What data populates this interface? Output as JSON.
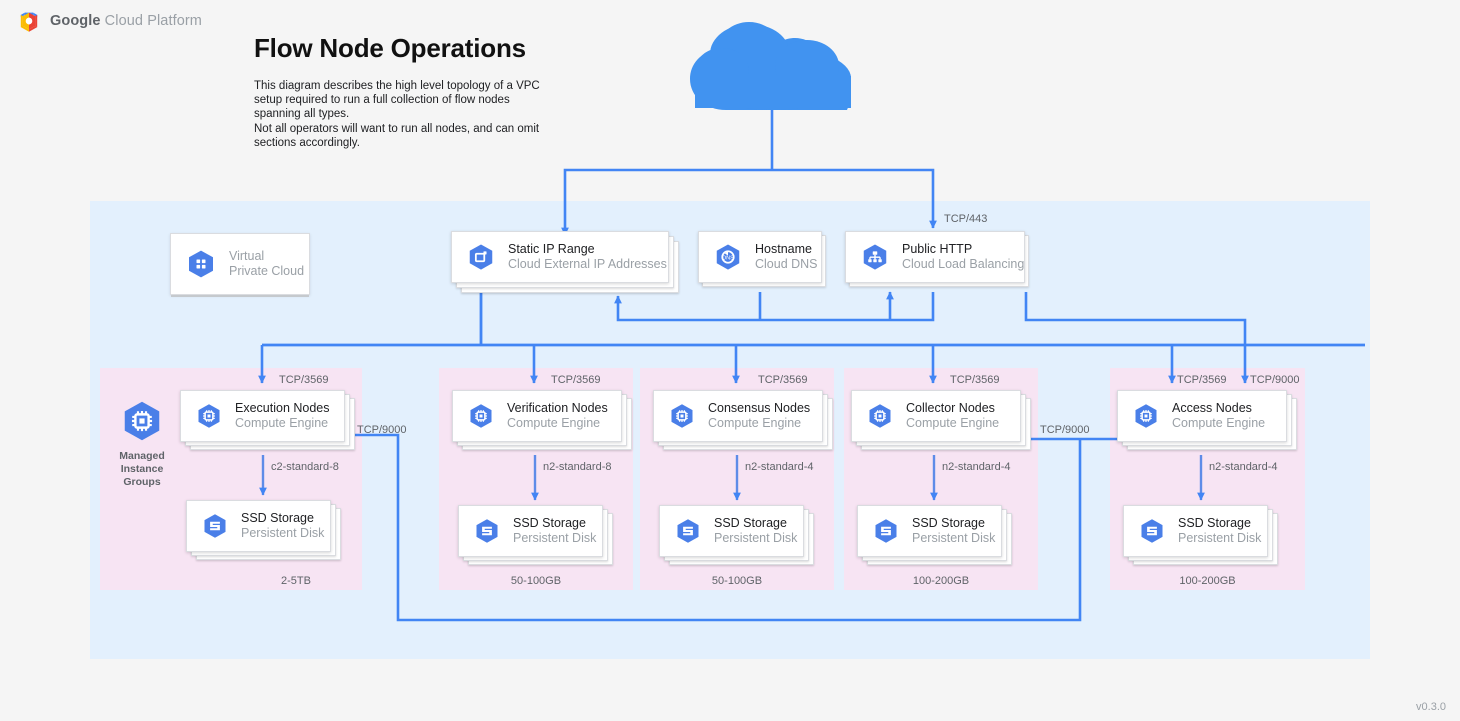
{
  "brand": {
    "bold": "Google",
    "rest": " Cloud Platform",
    "logo_icon": "google-cloud-platform-logo"
  },
  "header": {
    "title": "Flow Node Operations",
    "description_line1": "This diagram describes the high level topology of a VPC setup required to run a full collection of flow nodes spanning all types.",
    "description_line2": "Not all operators will want to run all nodes, and can omit sections accordingly."
  },
  "version": "v0.3.0",
  "colors": {
    "vpc_background": "#e3f0fd",
    "group_background": "#f7e4f3",
    "wire": "#4285f4",
    "cloud": "#4193f0",
    "icon_blue": "#4a7fe8",
    "page_background": "#f5f5f5",
    "label_gray": "#5f6368"
  },
  "internet": {
    "icon": "cloud-icon"
  },
  "vpc": {
    "label_primary": "Virtual",
    "label_secondary": "Private Cloud",
    "icon": "virtual-private-cloud-icon"
  },
  "services": [
    {
      "id": "static-ip-range",
      "title": "Static IP Range",
      "subtitle": "Cloud External IP Addresses",
      "icon": "cloud-external-ip-addresses-icon"
    },
    {
      "id": "hostname",
      "title": "Hostname",
      "subtitle": "Cloud DNS",
      "icon": "cloud-dns-icon"
    },
    {
      "id": "public-http",
      "title": "Public HTTP",
      "subtitle": "Cloud Load Balancing",
      "icon": "cloud-load-balancing-icon"
    }
  ],
  "managed_instance_groups": {
    "label_line1": "Managed",
    "label_line2": "Instance",
    "label_line3": "Groups",
    "icon": "managed-instance-groups-icon"
  },
  "node_groups": [
    {
      "id": "execution",
      "node_title": "Execution Nodes",
      "node_subtitle": "Compute Engine",
      "node_icon": "compute-engine-icon",
      "machine_type": "c2-standard-8",
      "storage_title": "SSD Storage",
      "storage_subtitle": "Persistent Disk",
      "storage_icon": "persistent-disk-icon",
      "storage_size": "2-5TB",
      "ingress_label": "TCP/3569"
    },
    {
      "id": "verification",
      "node_title": "Verification Nodes",
      "node_subtitle": "Compute Engine",
      "node_icon": "compute-engine-icon",
      "machine_type": "n2-standard-8",
      "storage_title": "SSD Storage",
      "storage_subtitle": "Persistent Disk",
      "storage_icon": "persistent-disk-icon",
      "storage_size": "50-100GB",
      "ingress_label": "TCP/3569"
    },
    {
      "id": "consensus",
      "node_title": "Consensus Nodes",
      "node_subtitle": "Compute Engine",
      "node_icon": "compute-engine-icon",
      "machine_type": "n2-standard-4",
      "storage_title": "SSD Storage",
      "storage_subtitle": "Persistent Disk",
      "storage_icon": "persistent-disk-icon",
      "storage_size": "50-100GB",
      "ingress_label": "TCP/3569"
    },
    {
      "id": "collector",
      "node_title": "Collector Nodes",
      "node_subtitle": "Compute Engine",
      "node_icon": "compute-engine-icon",
      "machine_type": "n2-standard-4",
      "storage_title": "SSD Storage",
      "storage_subtitle": "Persistent Disk",
      "storage_icon": "persistent-disk-icon",
      "storage_size": "100-200GB",
      "ingress_label": "TCP/3569"
    },
    {
      "id": "access",
      "node_title": "Access Nodes",
      "node_subtitle": "Compute Engine",
      "node_icon": "compute-engine-icon",
      "machine_type": "n2-standard-4",
      "storage_title": "SSD Storage",
      "storage_subtitle": "Persistent Disk",
      "storage_icon": "persistent-disk-icon",
      "storage_size": "100-200GB",
      "ingress_label": "TCP/3569"
    }
  ],
  "connection_labels": {
    "internet_to_lb": "TCP/443",
    "access_ingress_9000": "TCP/9000",
    "access_to_collector": "TCP/9000",
    "access_to_execution": "TCP/9000"
  }
}
